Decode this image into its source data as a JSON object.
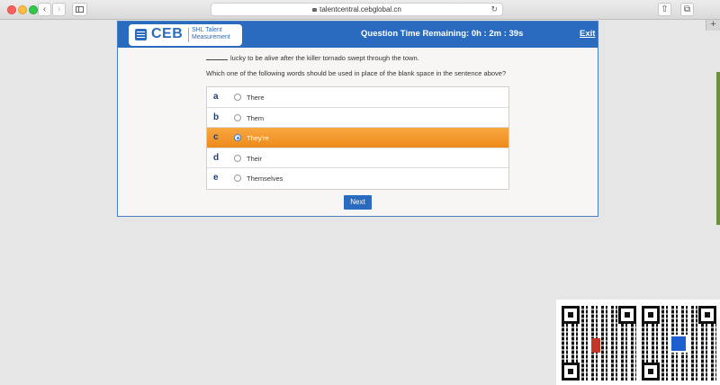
{
  "browser": {
    "url": "talentcentral.cebglobal.cn",
    "back_icon": "‹",
    "forward_icon": "›",
    "reload_icon": "↻",
    "share_icon": "⇧",
    "tabs_icon": "⧉",
    "plus_icon": "+"
  },
  "header": {
    "logo_text": "CEB",
    "logo_subtitle": "SHL Talent Measurement",
    "timer": "Question Time Remaining: 0h : 2m : 39s",
    "exit_label": "Exit",
    "bar_color": "#2a6bbf"
  },
  "question": {
    "sentence": "lucky to be alive after the killer tornado swept through the town.",
    "instruction": "Which one of the following words should be used in place of the blank space in the sentence above?"
  },
  "options": [
    {
      "letter": "a",
      "text": "There",
      "selected": false
    },
    {
      "letter": "b",
      "text": "Them",
      "selected": false
    },
    {
      "letter": "c",
      "text": "They're",
      "selected": true
    },
    {
      "letter": "d",
      "text": "Their",
      "selected": false
    },
    {
      "letter": "e",
      "text": "Themselves",
      "selected": false
    }
  ],
  "selection_color": "#f39a2c",
  "next_label": "Next"
}
